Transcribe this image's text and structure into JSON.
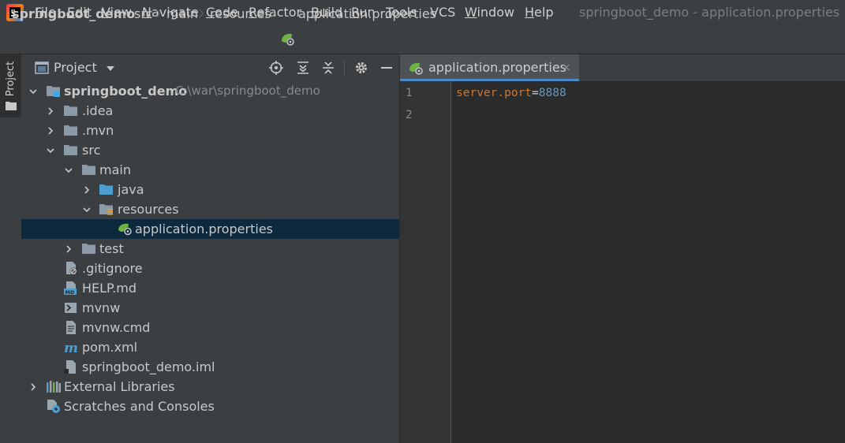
{
  "menu": {
    "items": [
      {
        "label": "File",
        "mnemonic": "F",
        "rest": "ile"
      },
      {
        "label": "Edit",
        "mnemonic": "E",
        "rest": "dit"
      },
      {
        "label": "View",
        "mnemonic": "V",
        "rest": "iew"
      },
      {
        "label": "Navigate",
        "mnemonic": "N",
        "rest": "avigate"
      },
      {
        "label": "Code",
        "mnemonic": "C",
        "rest": "ode"
      },
      {
        "label": "Refactor",
        "mnemonic": "R",
        "rest": "efactor"
      },
      {
        "label": "Build",
        "mnemonic": "B",
        "rest": "uild"
      },
      {
        "label": "Run",
        "mnemonic": "R",
        "rest": "un"
      },
      {
        "label": "Tools",
        "mnemonic": "T",
        "rest": "ools"
      },
      {
        "label": "VCS",
        "mnemonic": "",
        "rest": "VCS"
      },
      {
        "label": "Window",
        "mnemonic": "W",
        "rest": "indow"
      },
      {
        "label": "Help",
        "mnemonic": "H",
        "rest": "elp"
      }
    ],
    "window_title": "springboot_demo - application.properties"
  },
  "breadcrumb": {
    "items": [
      "springboot_demo",
      "src",
      "main",
      "resources",
      "application.properties"
    ]
  },
  "left_stripe": {
    "label": "Project"
  },
  "project_panel": {
    "title": "Project",
    "tree": [
      {
        "label": "springboot_demo",
        "path": "C:\\war\\springboot_demo",
        "icon": "module-folder-icon",
        "expanded": true
      },
      {
        "label": ".idea",
        "icon": "folder-icon",
        "expanded": false
      },
      {
        "label": ".mvn",
        "icon": "folder-icon",
        "expanded": false
      },
      {
        "label": "src",
        "icon": "folder-icon",
        "expanded": true
      },
      {
        "label": "main",
        "icon": "folder-icon",
        "expanded": true
      },
      {
        "label": "java",
        "icon": "source-folder-icon",
        "expanded": false
      },
      {
        "label": "resources",
        "icon": "resources-folder-icon",
        "expanded": true
      },
      {
        "label": "application.properties",
        "icon": "spring-properties-icon",
        "selected": true
      },
      {
        "label": "test",
        "icon": "folder-icon",
        "expanded": false
      },
      {
        "label": ".gitignore",
        "icon": "ignore-file-icon"
      },
      {
        "label": "HELP.md",
        "icon": "markdown-file-icon"
      },
      {
        "label": "mvnw",
        "icon": "shell-script-icon"
      },
      {
        "label": "mvnw.cmd",
        "icon": "text-file-icon"
      },
      {
        "label": "pom.xml",
        "icon": "maven-icon"
      },
      {
        "label": "springboot_demo.iml",
        "icon": "iml-file-icon"
      },
      {
        "label": "External Libraries",
        "icon": "libraries-icon",
        "expanded": false
      },
      {
        "label": "Scratches and Consoles",
        "icon": "scratches-icon"
      }
    ]
  },
  "editor": {
    "tab_label": "application.properties",
    "tab_close": "×",
    "line_numbers": [
      "1",
      "2"
    ],
    "code": {
      "key": "server.port",
      "eq": "=",
      "value": "8888"
    }
  },
  "colors": {
    "accent": "#4a88c7",
    "selection": "#0d293e",
    "key_color": "#cc7832",
    "value_color": "#6897bb",
    "spring_green": "#6db33f"
  }
}
